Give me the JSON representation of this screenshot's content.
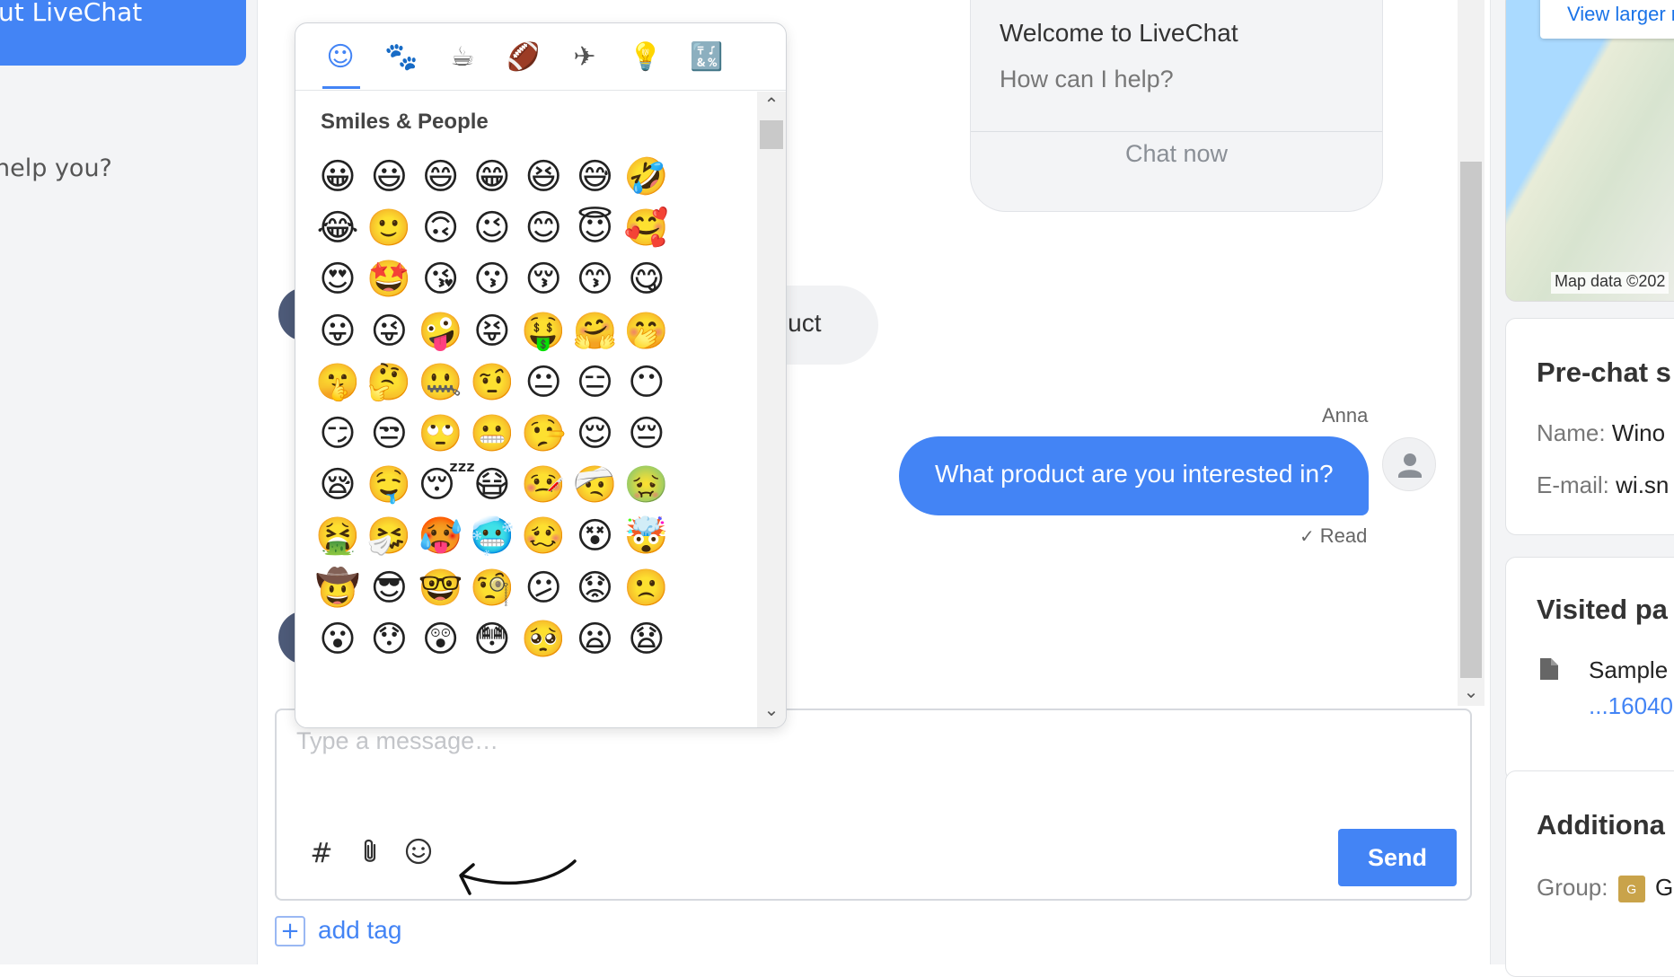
{
  "left": {
    "top_button_label": "ut LiveChat",
    "snippet": "help you?"
  },
  "welcome": {
    "title": "Welcome to LiveChat",
    "subtitle": "How can I help?",
    "cta": "Chat now"
  },
  "messages": {
    "customer_partial": "oduct",
    "agent_name": "Anna",
    "agent_message": "What product are you interested in?",
    "read_status": "Read"
  },
  "emoji_picker": {
    "categories": [
      "smiley-icon",
      "animal-icon",
      "food-icon",
      "ball-icon",
      "plane-icon",
      "bulb-icon",
      "symbols-icon"
    ],
    "category_glyphs": [
      "☺",
      "🐾",
      "☕",
      "🏈",
      "✈",
      "💡",
      "🔣"
    ],
    "section_title": "Smiles & People",
    "emojis": [
      [
        "😀",
        "😃",
        "😄",
        "😁",
        "😆",
        "😅",
        "🤣"
      ],
      [
        "😂",
        "🙂",
        "🙃",
        "😉",
        "😊",
        "😇",
        "🥰"
      ],
      [
        "😍",
        "🤩",
        "😘",
        "😗",
        "😚",
        "😙",
        "😋"
      ],
      [
        "😛",
        "😜",
        "🤪",
        "😝",
        "🤑",
        "🤗",
        "🤭"
      ],
      [
        "🤫",
        "🤔",
        "🤐",
        "🤨",
        "😐",
        "😑",
        "😶"
      ],
      [
        "😏",
        "😒",
        "🙄",
        "😬",
        "🤥",
        "😌",
        "😔"
      ],
      [
        "😪",
        "🤤",
        "😴",
        "😷",
        "🤒",
        "🤕",
        "🤢"
      ],
      [
        "🤮",
        "🤧",
        "🥵",
        "🥶",
        "🥴",
        "😵",
        "🤯"
      ],
      [
        "🤠",
        "😎",
        "🤓",
        "🧐",
        "😕",
        "😟",
        "🙁"
      ],
      [
        "😮",
        "😯",
        "😲",
        "😳",
        "🥺",
        "😦",
        "😧"
      ]
    ]
  },
  "composer": {
    "placeholder": "Type a message…",
    "hashtag_glyph": "#",
    "attach_glyph": "📎",
    "emoji_glyph": "☺",
    "send_label": "Send"
  },
  "add_tag": {
    "plus": "+",
    "label": "add tag"
  },
  "right": {
    "map_button": "View larger m",
    "map_data": "Map data ©202",
    "prechat_title": "Pre-chat s",
    "name_key": "Name:",
    "name_value": "Wino",
    "email_key": "E-mail:",
    "email_value": "wi.sn",
    "visited_title": "Visited pa",
    "visited_page": "Sample",
    "visited_link": "...16040",
    "additional_title": "Additiona",
    "group_key": "Group:",
    "group_badge": "G",
    "group_value": "G"
  },
  "colors": {
    "accent": "#4384f5",
    "panel_bg": "#f3f4f6"
  }
}
